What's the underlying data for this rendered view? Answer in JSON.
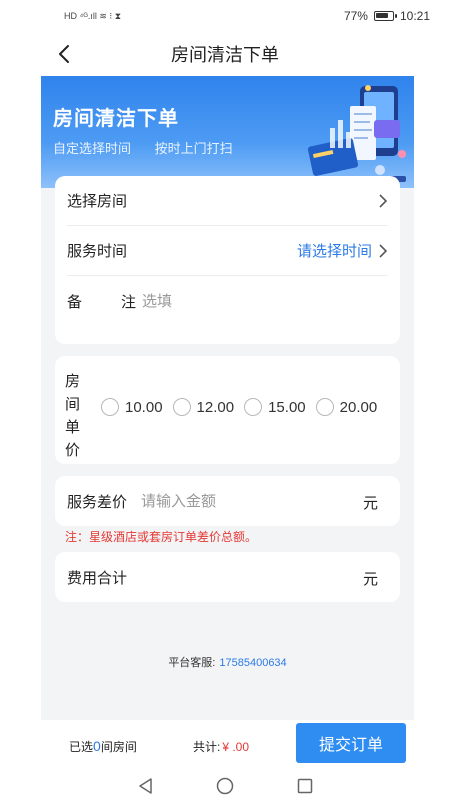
{
  "status_bar": {
    "left_icons": "HD ⁴ᴳ.ıll ≋ ⁝ ⧗",
    "battery_percent": "77%",
    "battery_level": 0.77,
    "time": "10:21"
  },
  "nav": {
    "title": "房间清洁下单",
    "back_icon": "chevron-left-icon"
  },
  "banner": {
    "title": "房间清洁下单",
    "subtitle_1": "自定选择时间",
    "subtitle_2": "按时上门打扫"
  },
  "form": {
    "room_label": "选择房间",
    "time_label": "服务时间",
    "time_value": "请选择时间",
    "remark_label_1": "备",
    "remark_label_2": "注",
    "remark_placeholder": "选填",
    "price_label": "房间单价",
    "price_options": [
      "10.00",
      "12.00",
      "15.00",
      "20.00"
    ],
    "diff_label": "服务差价",
    "diff_placeholder": "请输入金额",
    "diff_unit": "元",
    "note": "注：星级酒店或套房订单差价总额。",
    "total_label": "费用合计",
    "total_unit": "元"
  },
  "service": {
    "label": "平台客服:",
    "phone": "17585400634"
  },
  "bottom_bar": {
    "selected_prefix": "已选",
    "selected_count": "0",
    "selected_suffix": "间房间",
    "total_label": "共计:",
    "total_amount": "¥ .00",
    "submit_label": "提交订单"
  },
  "colors": {
    "accent": "#2f8cf0",
    "link": "#2c7be5",
    "warning": "#e53935",
    "background": "#f3f4f6"
  }
}
